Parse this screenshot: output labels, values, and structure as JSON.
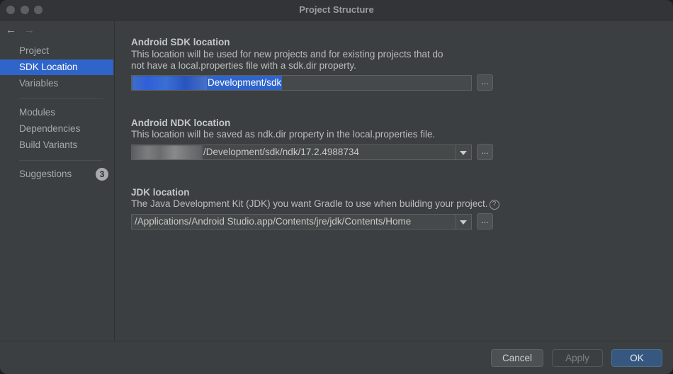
{
  "window": {
    "title": "Project Structure"
  },
  "nav": {
    "back": "←",
    "forward": "→"
  },
  "sidebar": {
    "items": [
      {
        "label": "Project"
      },
      {
        "label": "SDK Location"
      },
      {
        "label": "Variables"
      },
      {
        "label": "Modules"
      },
      {
        "label": "Dependencies"
      },
      {
        "label": "Build Variants"
      },
      {
        "label": "Suggestions",
        "badge": "3"
      }
    ],
    "selected": "SDK Location"
  },
  "sdk": {
    "title": "Android SDK location",
    "desc1": "This location will be used for new projects and for existing projects that do",
    "desc2": "not have a local.properties file with a sdk.dir property.",
    "value_visible": "Development/sdk",
    "browse": "..."
  },
  "ndk": {
    "title": "Android NDK location",
    "desc": "This location will be saved as ndk.dir property in the local.properties file.",
    "value_visible": "/Development/sdk/ndk/17.2.4988734",
    "browse": "..."
  },
  "jdk": {
    "title": "JDK location",
    "desc": "The Java Development Kit (JDK) you want Gradle to use when building your project.",
    "help": "?",
    "value": "/Applications/Android Studio.app/Contents/jre/jdk/Contents/Home",
    "browse": "..."
  },
  "footer": {
    "cancel": "Cancel",
    "apply": "Apply",
    "ok": "OK"
  },
  "colors": {
    "selection": "#2f65ca",
    "ok_button": "#365880",
    "background": "#3c3f41"
  }
}
